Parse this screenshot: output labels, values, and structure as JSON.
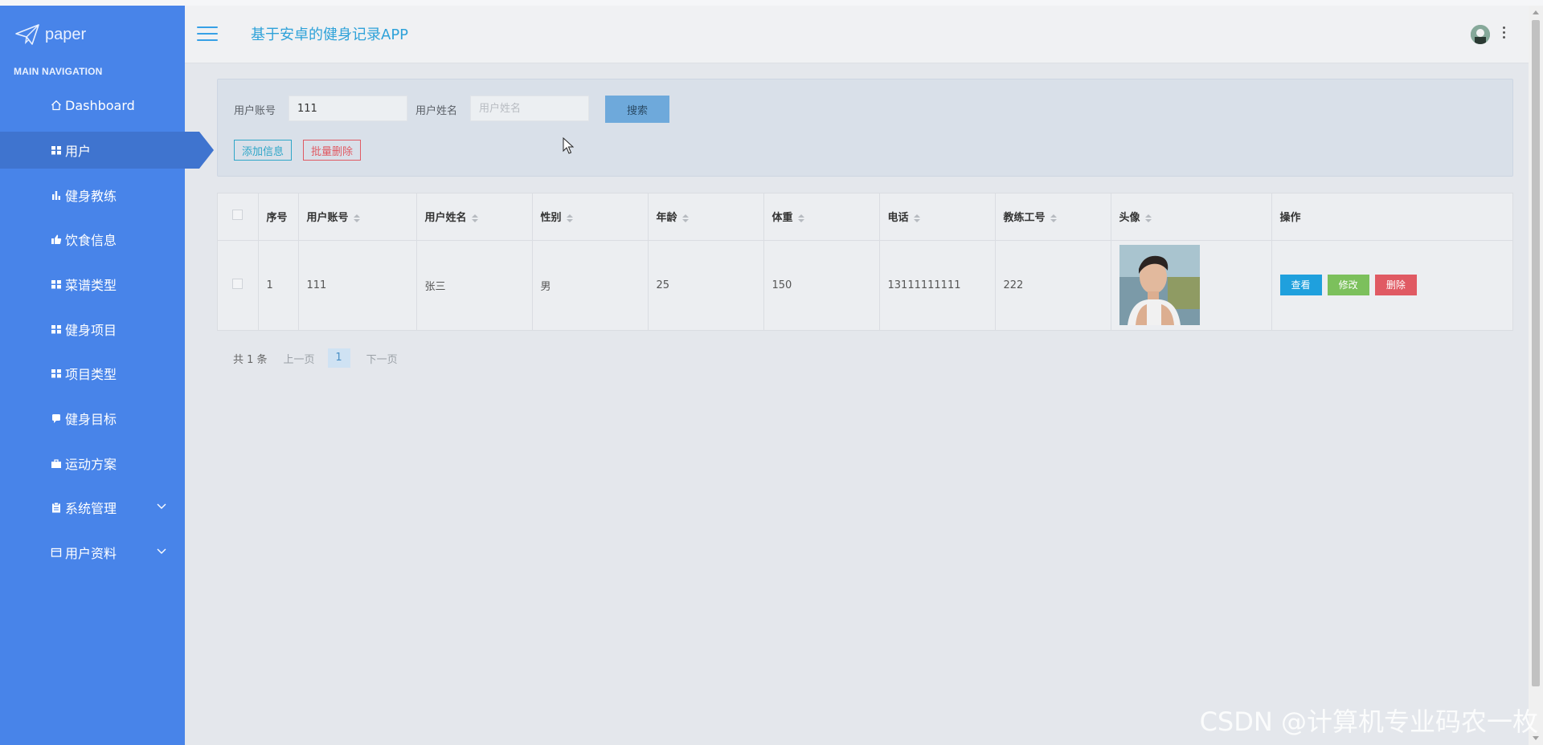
{
  "logo": {
    "text": "paper",
    "icon": "paper-plane-icon"
  },
  "nav": {
    "title": "MAIN NAVIGATION",
    "items": [
      {
        "label": "Dashboard",
        "icon": "home-icon"
      },
      {
        "label": "用户",
        "icon": "grid-icon",
        "active": true
      },
      {
        "label": "健身教练",
        "icon": "bar-chart-icon"
      },
      {
        "label": "饮食信息",
        "icon": "thumbs-up-icon"
      },
      {
        "label": "菜谱类型",
        "icon": "grid-icon"
      },
      {
        "label": "健身项目",
        "icon": "grid-icon"
      },
      {
        "label": "项目类型",
        "icon": "grid-icon"
      },
      {
        "label": "健身目标",
        "icon": "chat-icon"
      },
      {
        "label": "运动方案",
        "icon": "briefcase-icon"
      },
      {
        "label": "系统管理",
        "icon": "clipboard-icon",
        "expandable": true
      },
      {
        "label": "用户资料",
        "icon": "card-icon",
        "expandable": true
      }
    ]
  },
  "header": {
    "title": "基于安卓的健身记录APP"
  },
  "search": {
    "account_label": "用户账号",
    "account_value": "111",
    "name_label": "用户姓名",
    "name_placeholder": "用户姓名",
    "search_button": "搜索",
    "add_button": "添加信息",
    "batch_delete_button": "批量删除"
  },
  "table": {
    "columns": [
      "序号",
      "用户账号",
      "用户姓名",
      "性别",
      "年龄",
      "体重",
      "电话",
      "教练工号",
      "头像",
      "操作"
    ],
    "rows": [
      {
        "index": "1",
        "account": "111",
        "name": "张三",
        "gender": "男",
        "age": "25",
        "weight": "150",
        "phone": "13111111111",
        "coach_id": "222"
      }
    ],
    "actions": {
      "view": "查看",
      "edit": "修改",
      "delete": "删除"
    }
  },
  "pager": {
    "total": "共 1 条",
    "prev": "上一页",
    "current": "1",
    "next": "下一页"
  },
  "watermark": "CSDN @计算机专业码农一枚",
  "colors": {
    "sidebar": "#4884e9",
    "accent": "#2fa2d9",
    "view": "#1fa0dd",
    "edit": "#7cc05c",
    "delete": "#e05a63"
  }
}
